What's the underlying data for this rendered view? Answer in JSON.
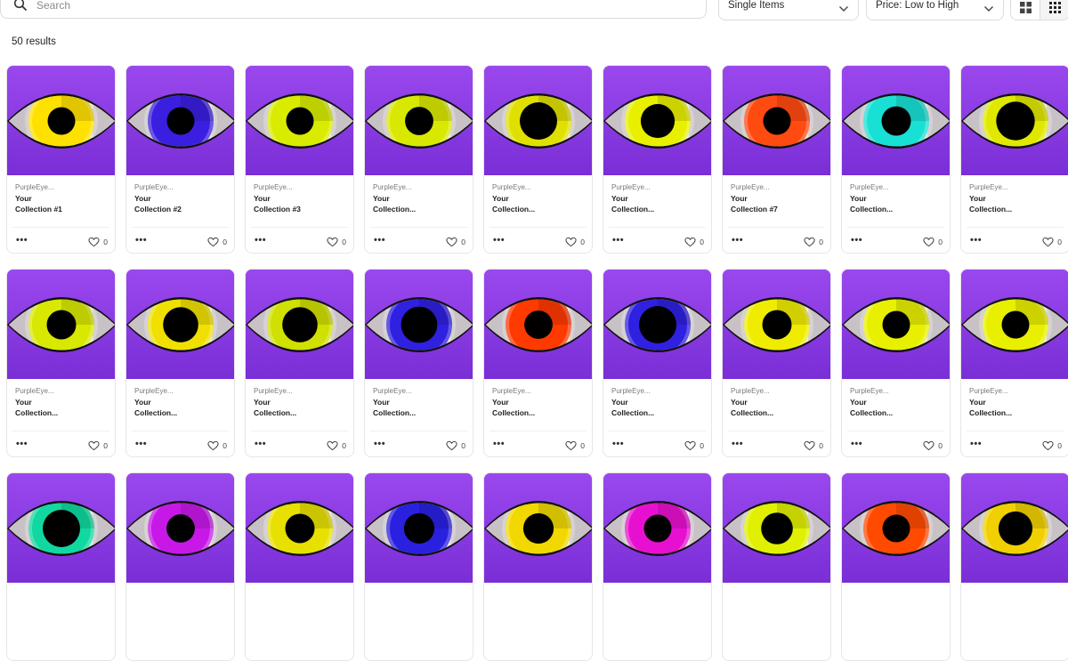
{
  "search": {
    "placeholder": "Search"
  },
  "filters": {
    "item_type": "Single Items",
    "sort": "Price: Low to High"
  },
  "results_text": "50 results",
  "accent_color": "#8a3ce4",
  "icons": {
    "search": "search-icon",
    "chevron": "chevron-down-icon",
    "heart": "heart-icon",
    "more": "more-options-icon",
    "grid_large": "grid-large-icon",
    "grid_small": "grid-small-icon"
  },
  "items": [
    {
      "creator": "PurpleEye...",
      "name1": "Your",
      "name2": "Collection #1",
      "likes": "0",
      "iris": "#ffe100",
      "pupil": 0.42
    },
    {
      "creator": "PurpleEye...",
      "name1": "Your",
      "name2": "Collection #2",
      "likes": "0",
      "iris": "#3b1fe0",
      "pupil": 0.42
    },
    {
      "creator": "PurpleEye...",
      "name1": "Your",
      "name2": "Collection #3",
      "likes": "0",
      "iris": "#d9ec00",
      "pupil": 0.42
    },
    {
      "creator": "PurpleEye...",
      "name1": "Your",
      "name2": "Collection...",
      "likes": "0",
      "iris": "#d8e800",
      "pupil": 0.45
    },
    {
      "creator": "PurpleEye...",
      "name1": "Your",
      "name2": "Collection...",
      "likes": "0",
      "iris": "#e0e000",
      "pupil": 0.85
    },
    {
      "creator": "PurpleEye...",
      "name1": "Your",
      "name2": "Collection...",
      "likes": "0",
      "iris": "#e8f000",
      "pupil": 0.7
    },
    {
      "creator": "PurpleEye...",
      "name1": "Your",
      "name2": "Collection #7",
      "likes": "0",
      "iris": "#ff4a10",
      "pupil": 0.42
    },
    {
      "creator": "PurpleEye...",
      "name1": "Your",
      "name2": "Collection...",
      "likes": "0",
      "iris": "#19e0d4",
      "pupil": 0.5
    },
    {
      "creator": "PurpleEye...",
      "name1": "Your",
      "name2": "Collection...",
      "likes": "0",
      "iris": "#e0e800",
      "pupil": 0.9
    },
    {
      "creator": "PurpleEye...",
      "name1": "Your",
      "name2": "Collection...",
      "likes": "0",
      "iris": "#d8e800",
      "pupil": 0.5
    },
    {
      "creator": "PurpleEye...",
      "name1": "Your",
      "name2": "Collection...",
      "likes": "0",
      "iris": "#f0e000",
      "pupil": 0.75
    },
    {
      "creator": "PurpleEye...",
      "name1": "Your",
      "name2": "Collection...",
      "likes": "0",
      "iris": "#d0e000",
      "pupil": 0.75
    },
    {
      "creator": "PurpleEye...",
      "name1": "Your",
      "name2": "Collection...",
      "likes": "0",
      "iris": "#3020e0",
      "pupil": 0.8
    },
    {
      "creator": "PurpleEye...",
      "name1": "Your",
      "name2": "Collection...",
      "likes": "0",
      "iris": "#ff3a00",
      "pupil": 0.45
    },
    {
      "creator": "PurpleEye...",
      "name1": "Your",
      "name2": "Collection...",
      "likes": "0",
      "iris": "#3020e0",
      "pupil": 0.85
    },
    {
      "creator": "PurpleEye...",
      "name1": "Your",
      "name2": "Collection...",
      "likes": "0",
      "iris": "#f0ec00",
      "pupil": 0.5
    },
    {
      "creator": "PurpleEye...",
      "name1": "Your",
      "name2": "Collection...",
      "likes": "0",
      "iris": "#e8f000",
      "pupil": 0.42
    },
    {
      "creator": "PurpleEye...",
      "name1": "Your",
      "name2": "Collection...",
      "likes": "0",
      "iris": "#e8f000",
      "pupil": 0.42
    },
    {
      "creator": "",
      "name1": "",
      "name2": "",
      "likes": "",
      "iris": "#10d8a0",
      "pupil": 0.85
    },
    {
      "creator": "",
      "name1": "",
      "name2": "",
      "likes": "",
      "iris": "#c818e8",
      "pupil": 0.45
    },
    {
      "creator": "",
      "name1": "",
      "name2": "",
      "likes": "",
      "iris": "#e8e000",
      "pupil": 0.5
    },
    {
      "creator": "",
      "name1": "",
      "name2": "",
      "likes": "",
      "iris": "#2a20e0",
      "pupil": 0.55
    },
    {
      "creator": "",
      "name1": "",
      "name2": "",
      "likes": "",
      "iris": "#f0d800",
      "pupil": 0.55
    },
    {
      "creator": "",
      "name1": "",
      "name2": "",
      "likes": "",
      "iris": "#e810d0",
      "pupil": 0.42
    },
    {
      "creator": "",
      "name1": "",
      "name2": "",
      "likes": "",
      "iris": "#e0f000",
      "pupil": 0.6
    },
    {
      "creator": "",
      "name1": "",
      "name2": "",
      "likes": "",
      "iris": "#ff4a00",
      "pupil": 0.42
    },
    {
      "creator": "",
      "name1": "",
      "name2": "",
      "likes": "",
      "iris": "#f0d000",
      "pupil": 0.7
    }
  ]
}
